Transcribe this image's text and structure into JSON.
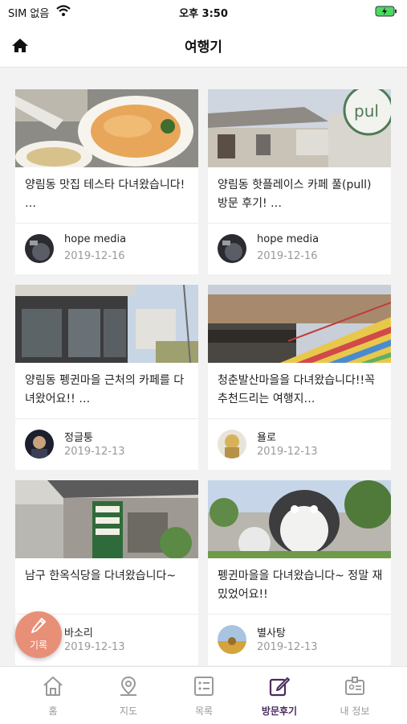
{
  "status_bar": {
    "carrier": "SIM 없음",
    "time": "오후 3:50"
  },
  "header": {
    "title": "여행기"
  },
  "posts": [
    {
      "title": "양림동 맛집 테스타 다녀왔습니다! …",
      "author": "hope media",
      "date": "2019-12-16"
    },
    {
      "title": "양림동 핫플레이스 카페 풀(pull) 방문 후기! …",
      "author": "hope media",
      "date": "2019-12-16"
    },
    {
      "title": "양림동 펭귄마을 근처의 카페를 다녀왔어요!! …",
      "author": "정글퉁",
      "date": "2019-12-13"
    },
    {
      "title": "청춘발산마을을 다녀왔습니다!!꼭 추천드리는 여행지…",
      "author": "욜로",
      "date": "2019-12-13"
    },
    {
      "title": "남구 한옥식당을 다녀왔습니다~",
      "author": "바소리",
      "date": "2019-12-13"
    },
    {
      "title": "펭귄마을을 다녀왔습니다~ 정말 재밌었어요!!",
      "author": "별사탕",
      "date": "2019-12-13"
    }
  ],
  "fab": {
    "label": "기록",
    "icon": "pencil-icon"
  },
  "tabs": [
    {
      "label": "홈",
      "icon": "home-icon"
    },
    {
      "label": "지도",
      "icon": "map-pin-icon"
    },
    {
      "label": "목록",
      "icon": "list-icon"
    },
    {
      "label": "방문후기",
      "icon": "review-edit-icon",
      "active": true
    },
    {
      "label": "내 정보",
      "icon": "profile-card-icon"
    }
  ],
  "colors": {
    "accent": "#4a2c5e",
    "fab": "#e88f78",
    "background": "#f2f2f2"
  }
}
